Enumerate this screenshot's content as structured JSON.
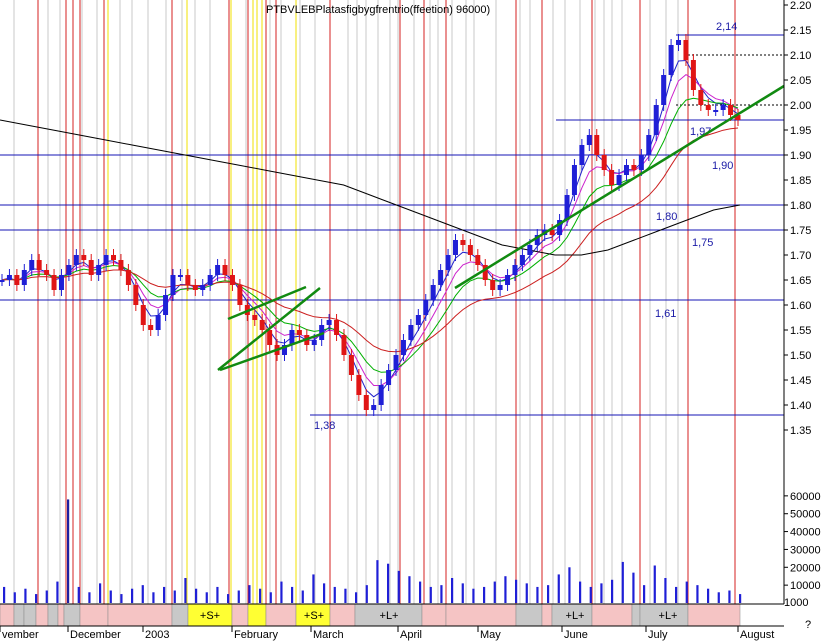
{
  "header": {
    "overlapping_title_text": "PTBVLEBPlatasfigbygfrentrio(ffeetion) 96000)"
  },
  "chart_data": {
    "type": "candlestick",
    "price_axis": {
      "ticks": [
        2.2,
        2.15,
        2.1,
        2.05,
        2.0,
        1.95,
        1.9,
        1.85,
        1.8,
        1.75,
        1.7,
        1.65,
        1.6,
        1.55,
        1.5,
        1.45,
        1.4,
        1.35
      ],
      "range": [
        1.3,
        2.2
      ]
    },
    "volume_axis": {
      "ticks": [
        60000,
        50000,
        40000,
        30000,
        20000,
        10000
      ],
      "range": [
        0,
        70000
      ],
      "unit_label": "1000"
    },
    "month_labels": [
      "vember",
      "December",
      "2003",
      "February",
      "March",
      "April",
      "May",
      "June",
      "July",
      "August"
    ],
    "extra_label": "?",
    "horizontal_levels": [
      {
        "value": 2.14,
        "label": "2,14"
      },
      {
        "value": 1.97,
        "label": "1,97"
      },
      {
        "value": 1.9,
        "label": "1,90"
      },
      {
        "value": 1.8,
        "label": "1,80"
      },
      {
        "value": 1.75,
        "label": "1,75"
      },
      {
        "value": 1.61,
        "label": "1,61"
      },
      {
        "value": 1.38,
        "label": "1,38"
      }
    ],
    "signal_bands": [
      "+S+",
      "+S+",
      "+L+",
      "+L+",
      "+L+"
    ],
    "price_series": {
      "x_start": "2002-11",
      "x_end": "2003-08",
      "close": [
        1.65,
        1.66,
        1.64,
        1.67,
        1.69,
        1.67,
        1.66,
        1.63,
        1.66,
        1.68,
        1.7,
        1.69,
        1.66,
        1.68,
        1.7,
        1.69,
        1.67,
        1.64,
        1.6,
        1.56,
        1.55,
        1.58,
        1.62,
        1.66,
        1.66,
        1.64,
        1.63,
        1.64,
        1.66,
        1.68,
        1.66,
        1.64,
        1.6,
        1.58,
        1.57,
        1.55,
        1.52,
        1.5,
        1.52,
        1.55,
        1.54,
        1.52,
        1.53,
        1.56,
        1.57,
        1.54,
        1.5,
        1.46,
        1.42,
        1.39,
        1.4,
        1.44,
        1.47,
        1.5,
        1.53,
        1.56,
        1.58,
        1.61,
        1.64,
        1.67,
        1.7,
        1.73,
        1.72,
        1.7,
        1.68,
        1.65,
        1.63,
        1.64,
        1.66,
        1.68,
        1.7,
        1.72,
        1.74,
        1.75,
        1.74,
        1.77,
        1.82,
        1.88,
        1.92,
        1.94,
        1.9,
        1.87,
        1.84,
        1.86,
        1.88,
        1.87,
        1.9,
        1.94,
        2.0,
        2.06,
        2.12,
        2.13,
        2.09,
        2.03,
        2.0,
        1.99,
        1.99,
        2.0,
        1.98,
        1.97
      ]
    },
    "sma_black": [
      1.97,
      1.96,
      1.95,
      1.94,
      1.93,
      1.92,
      1.91,
      1.9,
      1.89,
      1.88,
      1.87,
      1.86,
      1.85,
      1.84,
      1.82,
      1.8,
      1.78,
      1.76,
      1.74,
      1.72,
      1.71,
      1.7,
      1.7,
      1.71,
      1.73,
      1.75,
      1.77,
      1.79,
      1.8
    ],
    "ma_red_levels": [
      1.64,
      1.63,
      1.62,
      1.58,
      1.56,
      1.55,
      1.53,
      1.52,
      1.52,
      1.58,
      1.6,
      1.62,
      1.66,
      1.7,
      1.74,
      1.82,
      1.88,
      1.92
    ],
    "volume": [
      9000,
      6000,
      8000,
      5000,
      7000,
      12000,
      58000,
      9000,
      6000,
      11000,
      7000,
      5000,
      8000,
      10000,
      6000,
      9000,
      7000,
      14000,
      8000,
      6000,
      9000,
      5000,
      7000,
      10000,
      8000,
      6000,
      12000,
      9000,
      7000,
      16000,
      11000,
      9000,
      8000,
      6000,
      10000,
      24000,
      22000,
      18000,
      15000,
      12000,
      9000,
      10000,
      14000,
      11000,
      8000,
      9000,
      12000,
      15000,
      13000,
      11000,
      9000,
      10000,
      16000,
      20000,
      12000,
      9000,
      11000,
      13000,
      23000,
      17000,
      10000,
      21000,
      14000,
      9000,
      12000,
      10000,
      8000,
      6000,
      7000,
      5000
    ]
  },
  "colors": {
    "candle_up": "#1f1fd6",
    "candle_down": "#e01515",
    "red_line": "#cc0000",
    "yellow_line": "#f2e000",
    "gray_line": "#c8c8c8",
    "green_ma": "#00b000",
    "red_ma": "#cc2020",
    "black_ma": "#000000",
    "trend": "#118a11",
    "band_pink": "#f5c4c4",
    "band_gray": "#c8c8c8",
    "band_yellow": "#ffff33"
  }
}
